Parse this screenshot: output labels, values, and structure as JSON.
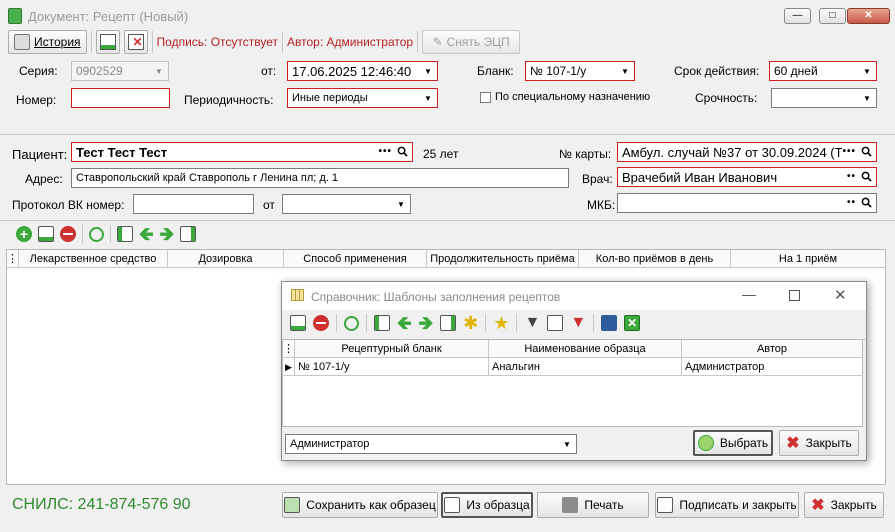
{
  "window": {
    "title": "Документ: Рецепт (Новый)"
  },
  "toolbar": {
    "history_label": "История",
    "signature_label": "Подпись: Отсутствует",
    "author_label": "Автор: Администратор",
    "remove_signature_label": "Снять ЭЦП"
  },
  "header": {
    "series_label": "Серия:",
    "series_value": "0902529",
    "from_label": "от:",
    "from_value": "17.06.2025 12:46:40",
    "form_label": "Бланк:",
    "form_value": "№ 107-1/у",
    "validity_label": "Срок действия:",
    "validity_value": "60 дней",
    "number_label": "Номер:",
    "number_value": "",
    "periodicity_label": "Периодичность:",
    "periodicity_value": "Иные периоды",
    "special_label": "По специальному назначению",
    "urgency_label": "Срочность:",
    "urgency_value": ""
  },
  "patient": {
    "patient_label": "Пациент:",
    "patient_value": "Тест Тест Тест",
    "age": "25 лет",
    "card_label": "№ карты:",
    "card_value": "Амбул. случай №37 от 30.09.2024 (Те",
    "address_label": "Адрес:",
    "address_value": "Ставропольский край Ставрополь г Ленина пл; д. 1",
    "doctor_label": "Врач:",
    "doctor_value": "Врачебий Иван Иванович",
    "vk_label": "Протокол ВК номер:",
    "vk_value": "",
    "vk_from_label": "от",
    "mkb_label": "МКБ:",
    "mkb_value": ""
  },
  "grid": {
    "columns": [
      "Лекарственное средство",
      "Дозировка",
      "Способ применения",
      "Продолжительность приёма",
      "Кол-во приёмов в день",
      "На 1 приём"
    ]
  },
  "dialog": {
    "title": "Справочник: Шаблоны заполнения рецептов",
    "columns": [
      "Рецептурный бланк",
      "Наименование образца",
      "Автор"
    ],
    "rows": [
      [
        "№ 107-1/у",
        "Анальгин",
        "Администратор"
      ]
    ],
    "filter_value": "Администратор",
    "select_label": "Выбрать",
    "close_label": "Закрыть"
  },
  "footer": {
    "snils": "СНИЛС: 241-874-576 90",
    "save_template_label": "Сохранить как образец",
    "from_template_label": "Из образца",
    "print_label": "Печать",
    "sign_close_label": "Подписать и закрыть",
    "close_label": "Закрыть"
  },
  "colors": {
    "required_border": "#d02020",
    "snils_text": "#2e8b2e",
    "accent_green": "#3aa83a",
    "stop_red": "#d03030"
  }
}
